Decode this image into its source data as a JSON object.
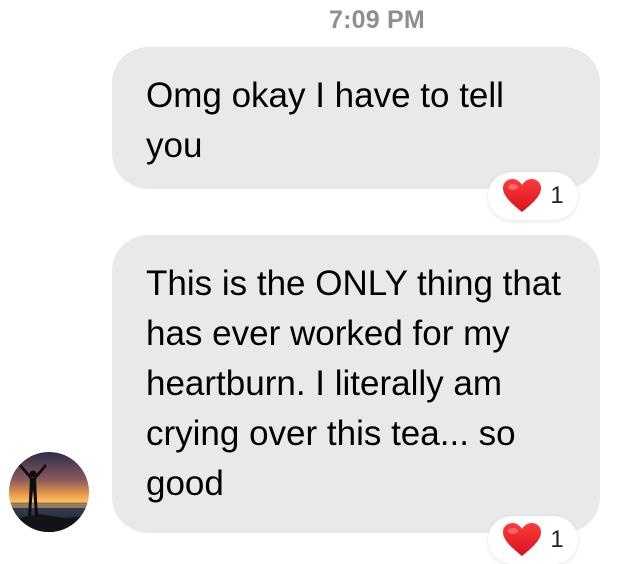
{
  "conversation": {
    "timestamp": "7:09 PM",
    "messages": [
      {
        "text": "Omg okay I have to tell you",
        "reaction": {
          "icon": "heart-icon",
          "color": "#e0202a",
          "count": "1"
        }
      },
      {
        "text": "This is the ONLY thing that has ever worked for my heartburn. I literally am crying over this tea... so good",
        "reaction": {
          "icon": "heart-icon",
          "color": "#e0202a",
          "count": "1"
        }
      }
    ],
    "sender_avatar": {
      "icon": "sunset-silhouette-avatar"
    },
    "colors": {
      "bubble_background": "#e9e9eb",
      "timestamp_text": "#8e8e93"
    }
  }
}
